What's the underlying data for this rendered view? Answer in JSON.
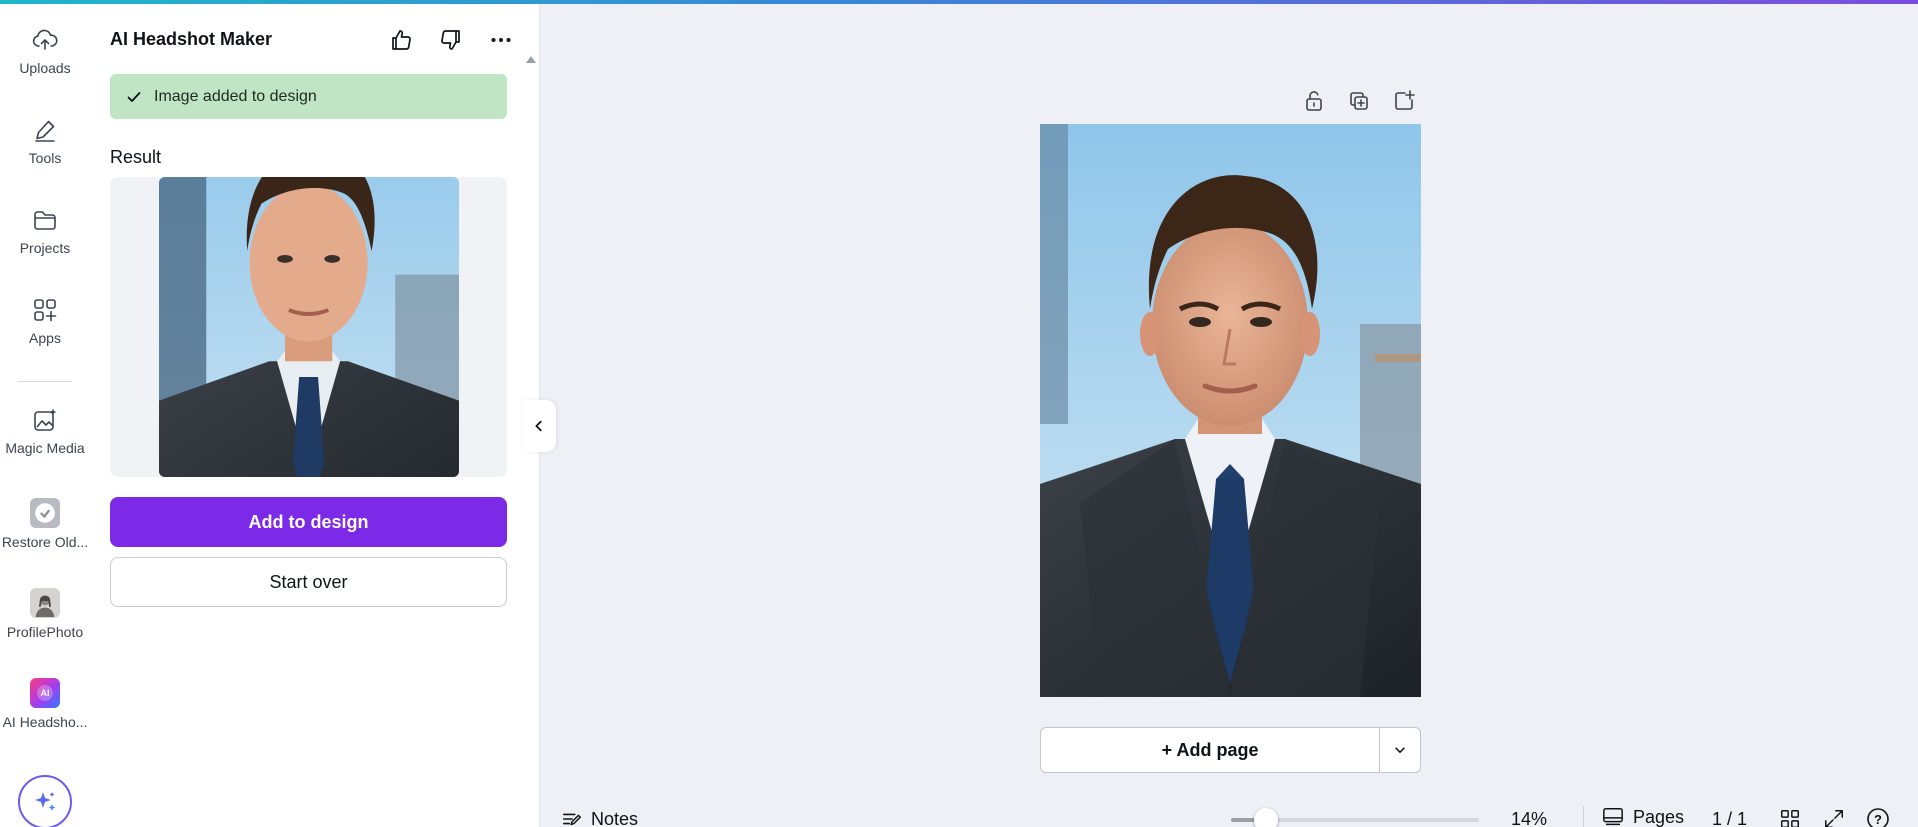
{
  "rail": {
    "items": [
      {
        "label": "Uploads",
        "icon": "cloud-upload-icon"
      },
      {
        "label": "Tools",
        "icon": "pen-tool-icon"
      },
      {
        "label": "Projects",
        "icon": "folder-icon"
      },
      {
        "label": "Apps",
        "icon": "apps-grid-icon"
      },
      {
        "label": "Magic Media",
        "icon": "magic-media-icon"
      },
      {
        "label": "Restore Old...",
        "icon": "restore-old-app-icon"
      },
      {
        "label": "ProfilePhoto",
        "icon": "profile-photo-app-icon"
      },
      {
        "label": "AI Headsho...",
        "icon": "ai-headshot-app-icon"
      }
    ],
    "ai_badge": "AI"
  },
  "panel": {
    "title": "AI Headshot Maker",
    "toast": "Image added to design",
    "result_heading": "Result",
    "primary_button": "Add to design",
    "secondary_button": "Start over"
  },
  "canvas": {
    "add_page_label": "+ Add page"
  },
  "bottom_bar": {
    "notes_label": "Notes",
    "zoom": "14%",
    "zoom_fraction": 0.14,
    "pages_label": "Pages",
    "page_count": "1 / 1",
    "help_label": "?"
  },
  "colors": {
    "accent": "#7d2ae8",
    "toast_bg": "#bfe5c4",
    "canvas_bg": "#eef0f5"
  }
}
